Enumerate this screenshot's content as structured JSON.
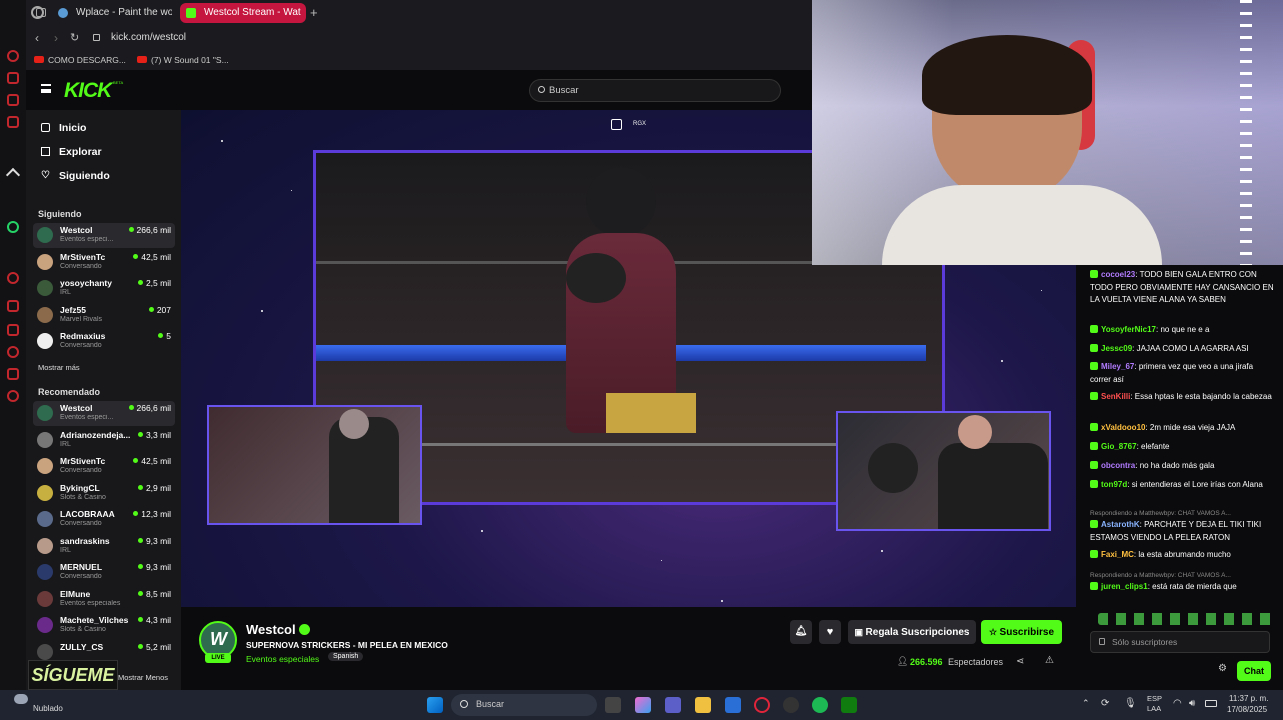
{
  "browser": {
    "tabs": [
      {
        "label": "Wplace - Paint the world",
        "active": false
      },
      {
        "label": "Westcol Stream - Wat",
        "active": true
      }
    ],
    "new_tab_glyph": "+",
    "url": "kick.com/westcol",
    "bookmarks": [
      "COMO DESCARG...",
      "(7) W Sound 01 \"S..."
    ]
  },
  "kick": {
    "logo": "KICK",
    "logo_badge": "BETA",
    "search_placeholder": "Buscar",
    "nav": [
      "Inicio",
      "Explorar",
      "Siguiendo"
    ],
    "following_title": "Siguiendo",
    "following": [
      {
        "name": "Westcol",
        "category": "Eventos especi...",
        "viewers": "266,6 mil",
        "color": "#2f6b4e"
      },
      {
        "name": "MrStivenTc",
        "category": "Conversando",
        "viewers": "42,5 mil",
        "color": "#c9a27e"
      },
      {
        "name": "yosoychanty",
        "category": "IRL",
        "viewers": "2,5 mil",
        "color": "#3a5a3a"
      },
      {
        "name": "Jefz55",
        "category": "Marvel Rivals",
        "viewers": "207",
        "color": "#8a6a4a"
      },
      {
        "name": "Redmaxius",
        "category": "Conversando",
        "viewers": "5",
        "color": "#eeeeee"
      }
    ],
    "show_more": "Mostrar más",
    "recommended_title": "Recomendado",
    "recommended": [
      {
        "name": "Westcol",
        "category": "Eventos especi...",
        "viewers": "266,6 mil",
        "color": "#2f6b4e"
      },
      {
        "name": "Adrianozendeja...",
        "category": "IRL",
        "viewers": "3,3 mil",
        "color": "#777777"
      },
      {
        "name": "MrStivenTc",
        "category": "Conversando",
        "viewers": "42,5 mil",
        "color": "#c9a27e"
      },
      {
        "name": "BykingCL",
        "category": "Slots & Casino",
        "viewers": "2,9 mil",
        "color": "#c8b040"
      },
      {
        "name": "LACOBRAAA",
        "category": "Conversando",
        "viewers": "12,3 mil",
        "color": "#5a6a8a"
      },
      {
        "name": "sandraskins",
        "category": "IRL",
        "viewers": "9,3 mil",
        "color": "#b89a8a"
      },
      {
        "name": "MERNUEL",
        "category": "Conversando",
        "viewers": "9,3 mil",
        "color": "#2a3a6a"
      },
      {
        "name": "ElMune",
        "category": "Eventos especiales",
        "viewers": "8,5 mil",
        "color": "#6a3a3a"
      },
      {
        "name": "Machete_Vilches",
        "category": "Slots & Casino",
        "viewers": "4,3 mil",
        "color": "#6a2a8a"
      },
      {
        "name": "ZULLY_CS",
        "category": "",
        "viewers": "5,2 mil",
        "color": "#4a4a4a"
      }
    ],
    "show_less": "Mostrar Menos",
    "sigueme": "SÍGUEME"
  },
  "player": {
    "overlay_label": "RGX"
  },
  "stream": {
    "live_badge": "LIVE",
    "channel": "Westcol",
    "title": "SUPERNOVA STRICKERS - MI PELEA EN MEXICO",
    "category": "Eventos especiales",
    "language": "Spanish",
    "gift_subs": "Regala Suscripciones",
    "subscribe": "Suscribirse",
    "viewers_count": "266.596",
    "viewers_label": "Espectadores"
  },
  "chat": {
    "messages": [
      {
        "user": "cocoel23",
        "color": "#b27cff",
        "text": "TODO BIEN GALA ENTRO CON TODO PERO OBVIAMENTE HAY CANSANCIO EN LA VUELTA VIENE ALANA YA SABEN"
      },
      {
        "user": "YosoyferNic17",
        "color": "#53fc18",
        "text": "no que ne e a"
      },
      {
        "user": "Jessc09",
        "color": "#53fc18",
        "text": "JAJAA COMO LA AGARRA ASI"
      },
      {
        "user": "Miley_67",
        "color": "#b27cff",
        "text": "primera vez que veo a una jirafa correr así"
      },
      {
        "user": "SenKilli",
        "color": "#ff4f4f",
        "text": "Essa hptas le esta bajando la cabezaa"
      },
      {
        "user": "xValdooo10",
        "color": "#ffc040",
        "text": "2m mide esa vieja JAJA"
      },
      {
        "user": "Gio_8767",
        "color": "#53fc18",
        "text": "elefante"
      },
      {
        "user": "obcontra",
        "color": "#b27cff",
        "text": "no ha dado más gala"
      },
      {
        "user": "ton97d",
        "color": "#53fc18",
        "text": "si entendieras el Lore irías con Alana"
      },
      {
        "user": "AstarothK",
        "color": "#8ab4ff",
        "text": "PARCHATE Y DEJA EL TIKI TIKI ESTAMOS VIENDO LA PELEA RATON",
        "reply": "Respondiendo a Matthewbpv: CHAT VAMOS A..."
      },
      {
        "user": "Faxi_MC",
        "color": "#ffc040",
        "text": "la esta abrumando mucho"
      },
      {
        "user": "juren_clips1",
        "color": "#53fc18",
        "text": "está rata de mierda que",
        "reply": "Respondiendo a Matthewbpv: CHAT VAMOS A..."
      }
    ],
    "input_placeholder": "Sólo suscriptores",
    "send_label": "Chat"
  },
  "taskbar": {
    "weather": "Nublado",
    "search_placeholder": "Buscar",
    "lang_line1": "ESP",
    "lang_line2": "LAA",
    "time": "11:37 p. m.",
    "date": "17/08/2025"
  }
}
